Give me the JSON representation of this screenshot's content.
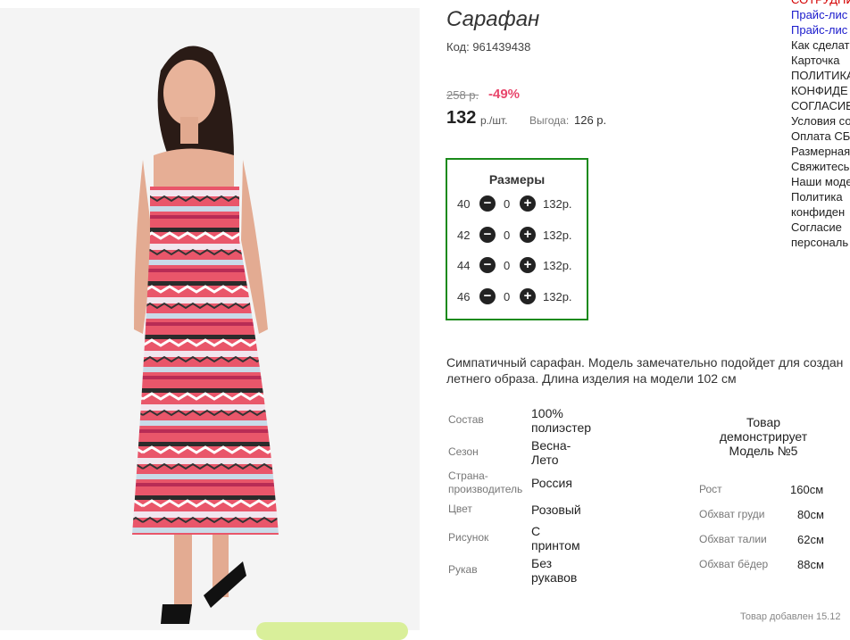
{
  "product": {
    "title": "Сарафан",
    "code": "Код: 961439438",
    "old_price": "258 р.",
    "discount": "-49%",
    "price": "132",
    "price_unit": "р./шт.",
    "benefit_label": "Выгода:",
    "benefit_value": "126 р."
  },
  "sizes": {
    "title": "Размеры",
    "rows": [
      {
        "size": "40",
        "qty": "0",
        "price": "132р."
      },
      {
        "size": "42",
        "qty": "0",
        "price": "132р."
      },
      {
        "size": "44",
        "qty": "0",
        "price": "132р."
      },
      {
        "size": "46",
        "qty": "0",
        "price": "132р."
      }
    ]
  },
  "description": "Симпатичный сарафан. Модель замечательно подойдет для создан летнего образа. Длина изделия на модели 102 см",
  "specs": [
    {
      "label": "Состав",
      "value": "100% полиэстер"
    },
    {
      "label": "Сезон",
      "value": "Весна-Лето"
    },
    {
      "label": "Страна-производитель",
      "value": "Россия"
    },
    {
      "label": "Цвет",
      "value": "Розовый"
    },
    {
      "label": "Рисунок",
      "value": "С принтом"
    },
    {
      "label": "Рукав",
      "value": "Без рукавов"
    }
  ],
  "model": {
    "note": "Товар демонстрирует Модель №5",
    "params": [
      {
        "label": "Рост",
        "value": "160см"
      },
      {
        "label": "Обхват груди",
        "value": "80см"
      },
      {
        "label": "Обхват талии",
        "value": "62см"
      },
      {
        "label": "Обхват бёдер",
        "value": "88см"
      }
    ]
  },
  "added": "Товар добавлен 15.12",
  "side_links": [
    "СОТРУДНИ",
    "Прайс-лис",
    "Прайс-лис",
    "Как сделат",
    "Карточка",
    "ПОЛИТИКА",
    "КОНФИДЕ",
    "СОГЛАСИЕ",
    "Условия со",
    "Оплата СБ",
    "Размерная",
    "Свяжитесь",
    "Наши моде",
    "Политика",
    "конфиден",
    "Согласие",
    "персональ"
  ],
  "colors": {
    "accent_green": "#1a8a1a",
    "discount_red": "#e8476c",
    "link_blue": "#1a1acc",
    "alert_red": "#d40000"
  },
  "icons": {
    "minus": "minus-circle-icon",
    "plus": "plus-circle-icon"
  }
}
